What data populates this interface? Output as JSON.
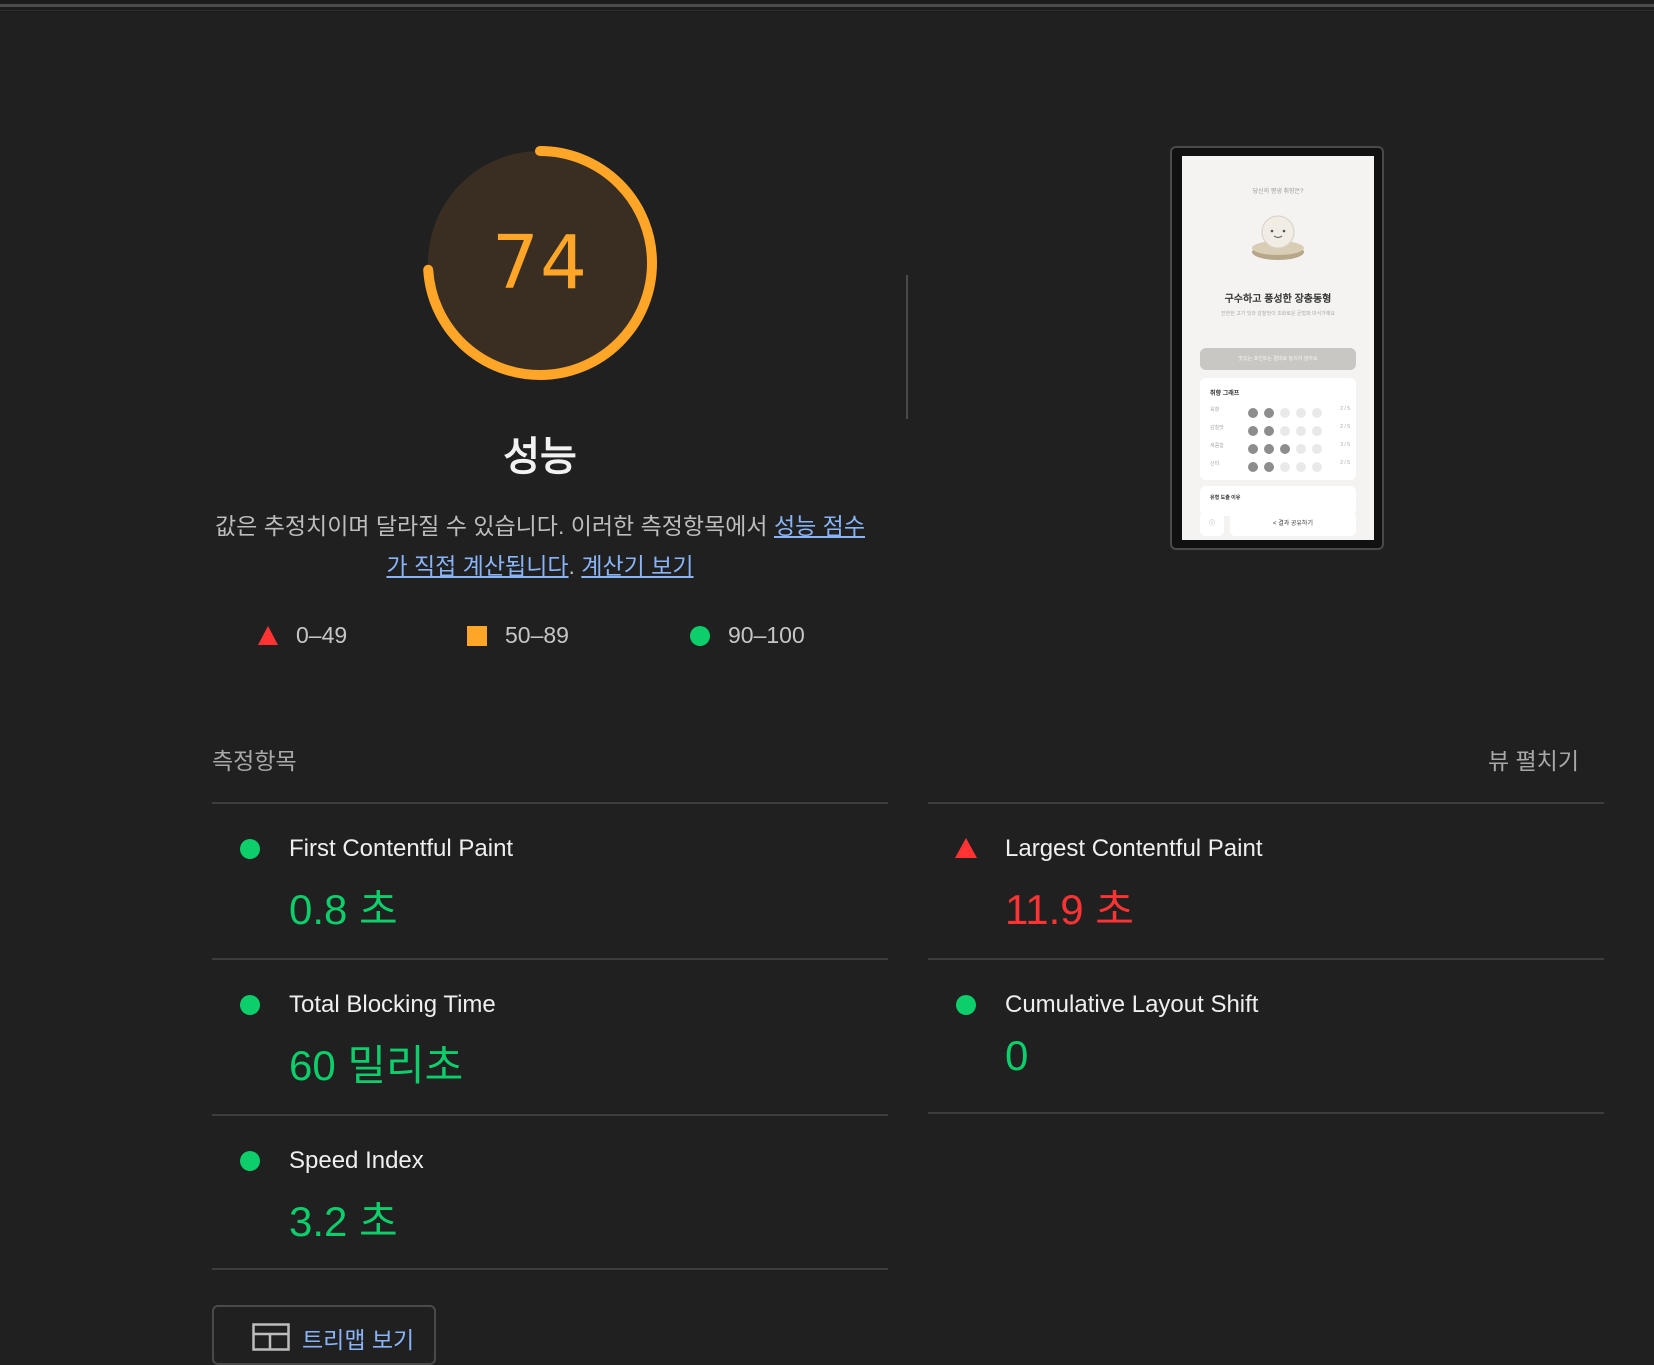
{
  "gauge": {
    "score": "74",
    "score_fraction": 0.74,
    "title": "성능",
    "color": "#ffa629"
  },
  "description": {
    "prefix": "값은 추정치이며 달라질 수 있습니다. 이러한 측정항목에서 ",
    "link1": "성능 점수가 직접 계산됩니다",
    "middle": ". ",
    "link2": "계산기 보기"
  },
  "legend": [
    {
      "shape": "triangle",
      "range": "0–49",
      "color": "#ff3333"
    },
    {
      "shape": "square",
      "range": "50–89",
      "color": "#ffa629"
    },
    {
      "shape": "circle",
      "range": "90–100",
      "color": "#0cce6b"
    }
  ],
  "thumbnail": {
    "question": "당신의 평냉 취향은?",
    "title": "구수하고 풍성한 장충동형",
    "subtitle": "진한한 고기 맛과 감칠맛이 조화로운 균형파 미식가예요",
    "button": "맛있는 포인트는 절대로 놓치지 않아요",
    "chart_title": "취향 그래프",
    "rows": [
      {
        "label": "육향",
        "on": 2,
        "value": "2 / 5"
      },
      {
        "label": "감칠맛",
        "on": 2,
        "value": "2 / 5"
      },
      {
        "label": "새콤함",
        "on": 3,
        "value": "3 / 5"
      },
      {
        "label": "산미",
        "on": 2,
        "value": "2 / 5"
      }
    ],
    "section2": "유형 도출 이유",
    "share": "결과 공유하기",
    "small_btn": "ⓘ"
  },
  "metrics_header": {
    "title": "측정항목",
    "expand": "뷰 펼치기"
  },
  "metrics": [
    {
      "name": "First Contentful Paint",
      "value": "0.8 초",
      "status": "good"
    },
    {
      "name": "Largest Contentful Paint",
      "value": "11.9 초",
      "status": "poor"
    },
    {
      "name": "Total Blocking Time",
      "value": "60 밀리초",
      "status": "good"
    },
    {
      "name": "Cumulative Layout Shift",
      "value": "0",
      "status": "good"
    },
    {
      "name": "Speed Index",
      "value": "3.2 초",
      "status": "good"
    }
  ],
  "treemap": {
    "label": "트리맵 보기"
  }
}
